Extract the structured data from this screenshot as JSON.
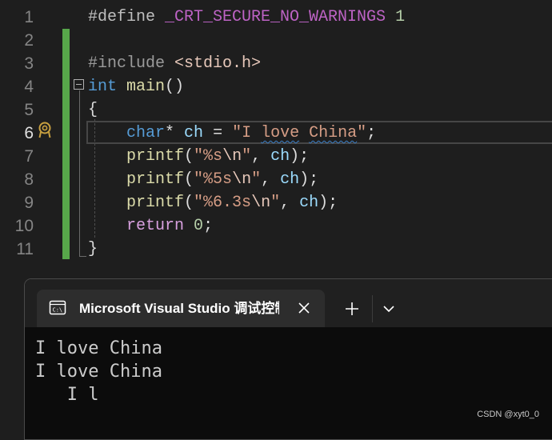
{
  "editor": {
    "active_line": "6",
    "lines": [
      {
        "n": "1",
        "macro": "#define ",
        "name": "_CRT_SECURE_NO_WARNINGS",
        "value": "1"
      },
      {
        "n": "2"
      },
      {
        "n": "3",
        "directive": "#include ",
        "path": "<stdio.h>"
      },
      {
        "n": "4",
        "type": "int",
        "func": "main",
        "parens": "()"
      },
      {
        "n": "5",
        "brace": "{"
      },
      {
        "n": "6",
        "type": "char",
        "rest": "* ",
        "var": "ch",
        "eq": " = ",
        "str_a": "\"I ",
        "str_b": "love",
        "str_c": " ",
        "str_d": "China",
        "str_e": "\"",
        "semi": ";"
      },
      {
        "n": "7",
        "func": "printf",
        "open": "(",
        "str_a": "\"%s",
        "esc": "\\n",
        "str_b": "\"",
        "comma": ", ",
        "var": "ch",
        "close": ");"
      },
      {
        "n": "8",
        "func": "printf",
        "open": "(",
        "str_a": "\"%5s",
        "esc": "\\n",
        "str_b": "\"",
        "comma": ", ",
        "var": "ch",
        "close": ");"
      },
      {
        "n": "9",
        "func": "printf",
        "open": "(",
        "str_a": "\"%6.3s",
        "esc": "\\n",
        "str_b": "\"",
        "comma": ", ",
        "var": "ch",
        "close": ");"
      },
      {
        "n": "10",
        "kw": "return",
        "sp": " ",
        "num": "0",
        "semi": ";"
      },
      {
        "n": "11",
        "brace": "}"
      }
    ]
  },
  "terminal": {
    "tab_title": "Microsoft Visual Studio 调试控制台",
    "output": [
      "I love China",
      "I love China",
      "   I l"
    ]
  },
  "watermark": "CSDN @xyt0_0",
  "icons": {
    "tab": "console-window-icon",
    "close": "close-icon",
    "new_tab": "plus-icon",
    "dropdown": "chevron-down-icon",
    "gutter": "breakpoint-cursor-icon",
    "collapse": "collapse-minus-icon"
  },
  "colors": {
    "editor_bg": "#1e1e1e",
    "keyword": "#569cd6",
    "control_keyword": "#d8a0df",
    "function": "#dcdcaa",
    "variable": "#9cdcfe",
    "string": "#d69d85",
    "macro": "#bd63c5",
    "number": "#b5cea8",
    "change_bar": "#57a64a",
    "gutter_icon": "#c8a040",
    "terminal_bg": "#0c0c0c"
  }
}
